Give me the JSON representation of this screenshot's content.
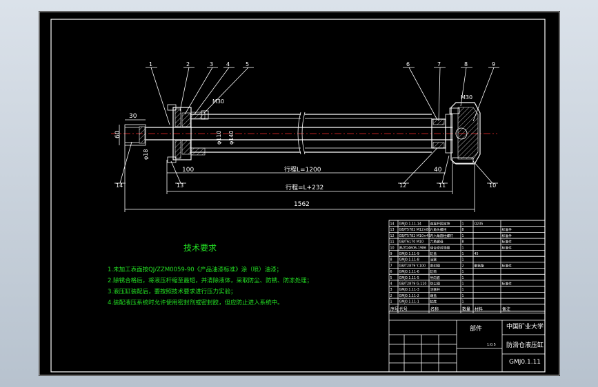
{
  "drawing": {
    "title": "技术要求",
    "requirements": [
      "1.未加工表面按QJ/ZZM0059-90《产品油漆标准》涂（喷）油漆；",
      "2.除锈合格后，将液压杆缩至最短，并清除液体，采取防尘、防锈、防冻处理；",
      "3.液压缸装配后，要按照技术要求进行压力实验；",
      "4.装配液压系统时允许使用密封剂或密封胶，但应防止进入系统中。"
    ],
    "balloons_top": [
      "1",
      "2",
      "3",
      "4",
      "5",
      "6",
      "7",
      "8",
      "9"
    ],
    "balloons_bottom": [
      "14",
      "13",
      "12",
      "11",
      "10"
    ],
    "dims": {
      "d30": "30",
      "d60": "60",
      "phi18": "φ18",
      "m30a": "M30",
      "m30b": "M30",
      "phi110": "φ110",
      "phi140": "φ140",
      "d100": "100",
      "d40": "40",
      "stroke": "行程L=1200",
      "stroke2": "行程=L+232",
      "total": "1562"
    }
  },
  "title_block": {
    "school": "中国矿业大学",
    "part_name": "防滑仓液压缸",
    "drawing_no": "GMJ0.1.11",
    "label_part": "部件",
    "headers": {
      "seq": "序号",
      "code": "代号",
      "name": "名称",
      "qty": "数量",
      "material": "材料",
      "note": "备注"
    },
    "scale": "1:0.5",
    "rows": [
      {
        "seq": "14",
        "code": "GMJ0.1.11-14",
        "name": "连接杆固定块",
        "qty": "1",
        "material": "Q235",
        "note": ""
      },
      {
        "seq": "13",
        "code": "GB/T5782 M12×80",
        "name": "六角头螺栓",
        "qty": "8",
        "material": "",
        "note": "标准件"
      },
      {
        "seq": "12",
        "code": "GB/T5782 M10×45",
        "name": "内六角圆柱螺钉",
        "qty": "1",
        "material": "",
        "note": "标准件"
      },
      {
        "seq": "11",
        "code": "GB/T6170 M10",
        "name": "六角螺母",
        "qty": "8",
        "material": "",
        "note": "标准件"
      },
      {
        "seq": "10",
        "code": "JB/ZQ4606-1986",
        "name": "组合密封垫圈",
        "qty": "1",
        "material": "",
        "note": "标准件"
      },
      {
        "seq": "9",
        "code": "GMJ0.1.11-9",
        "name": "缸盖",
        "qty": "1",
        "material": "45",
        "note": ""
      },
      {
        "seq": "8",
        "code": "GMJ0.1.11-8",
        "name": "活塞",
        "qty": "1",
        "material": "",
        "note": ""
      },
      {
        "seq": "7",
        "code": "GB/T2879 Y-100",
        "name": "密封圈",
        "qty": "2",
        "material": "聚氨酯",
        "note": "标准件"
      },
      {
        "seq": "6",
        "code": "GMJ0.1.11-6",
        "name": "缸筒",
        "qty": "1",
        "material": "",
        "note": ""
      },
      {
        "seq": "5",
        "code": "GMJ0.1.11-5",
        "name": "导向套",
        "qty": "1",
        "material": "",
        "note": ""
      },
      {
        "seq": "4",
        "code": "GB/T2879 G-110",
        "name": "防尘圈",
        "qty": "1",
        "material": "",
        "note": "标准件"
      },
      {
        "seq": "3",
        "code": "GMJ0.1.11-3",
        "name": "活塞杆",
        "qty": "1",
        "material": "",
        "note": ""
      },
      {
        "seq": "2",
        "code": "GMJ0.1.11-2",
        "name": "端盖",
        "qty": "1",
        "material": "",
        "note": ""
      },
      {
        "seq": "1",
        "code": "GMJ0.1.11-1",
        "name": "缸底",
        "qty": "1",
        "material": "",
        "note": ""
      }
    ]
  }
}
